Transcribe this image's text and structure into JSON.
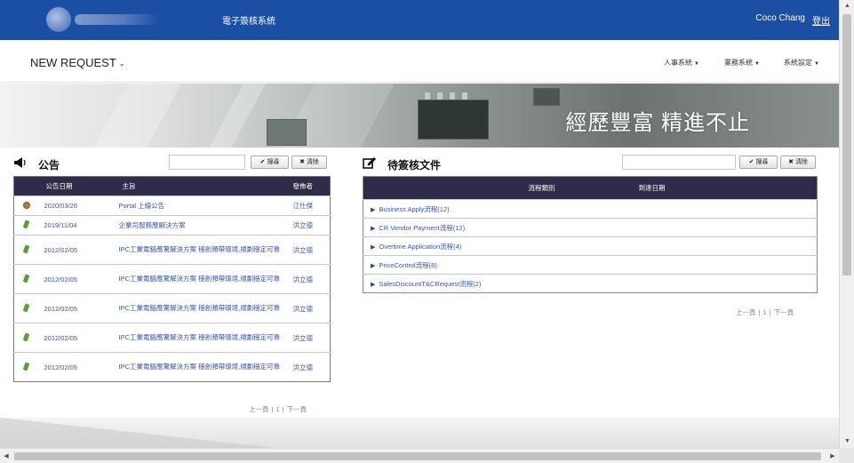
{
  "header": {
    "app_title": "電子簽核系統",
    "user_name": "Coco Chang",
    "logout_label": "登出"
  },
  "nav": {
    "new_request_label": "NEW REQUEST",
    "menus": [
      {
        "label": "人事系統"
      },
      {
        "label": "業務系統"
      },
      {
        "label": "系統設定"
      }
    ]
  },
  "banner": {
    "slogan": "經歷豐富 精進不止"
  },
  "announcements": {
    "title": "公告",
    "search_placeholder": "",
    "search_label": "搜尋",
    "clear_label": "清除",
    "columns": [
      "公告日期",
      "主旨",
      "發佈者"
    ],
    "rows": [
      {
        "icon": "new-icon",
        "date": "2020/03/26",
        "subject": "Portal 上線公告",
        "publisher": "江仕傑"
      },
      {
        "icon": "pin-icon",
        "date": "2019/11/04",
        "subject": "企業司服務應解決方案",
        "publisher": "洪立德"
      },
      {
        "icon": "pin-icon",
        "date": "2012/02/05",
        "subject": "IPC工業電腦應驚解決方案 穩創頻帶環境,規劃穩定可靠",
        "publisher": "洪立德"
      },
      {
        "icon": "pin-icon",
        "date": "2012/02/05",
        "subject": "IPC工業電腦應驚解決方案 穩創頻帶環境,規劃穩定可靠",
        "publisher": "洪立德"
      },
      {
        "icon": "pin-icon",
        "date": "2012/02/05",
        "subject": "IPC工業電腦應驚解決方案 穩創頻帶環境,規劃穩定可靠",
        "publisher": "洪立德"
      },
      {
        "icon": "pin-icon",
        "date": "2012/02/05",
        "subject": "IPC工業電腦應驚解決方案 穩創頻帶環境,規劃穩定可靠",
        "publisher": "洪立德"
      },
      {
        "icon": "pin-icon",
        "date": "2012/02/05",
        "subject": "IPC工業電腦應驚解決方案 穩創頻帶環境,規劃穩定可靠",
        "publisher": "洪立德"
      }
    ],
    "pager": {
      "prev": "上一頁",
      "page": "1",
      "next": "下一頁"
    }
  },
  "pending": {
    "title": "待簽核文件",
    "search_placeholder": "",
    "search_label": "搜尋",
    "clear_label": "清除",
    "columns": [
      "流程類別",
      "到達日期"
    ],
    "rows": [
      {
        "label": "Business Apply流程(12)"
      },
      {
        "label": "CR Vendor Payment流程(12)"
      },
      {
        "label": "Overtime Application流程(4)"
      },
      {
        "label": "PriceControl流程(8)"
      },
      {
        "label": "SalesDiscountT&CRequest流程(2)"
      }
    ],
    "pager": {
      "prev": "上一頁",
      "page": "1",
      "next": "下一頁"
    }
  },
  "colors": {
    "topbar": "#1a4fa3",
    "table_header": "#2e2c4a",
    "link": "#3a57a8"
  }
}
